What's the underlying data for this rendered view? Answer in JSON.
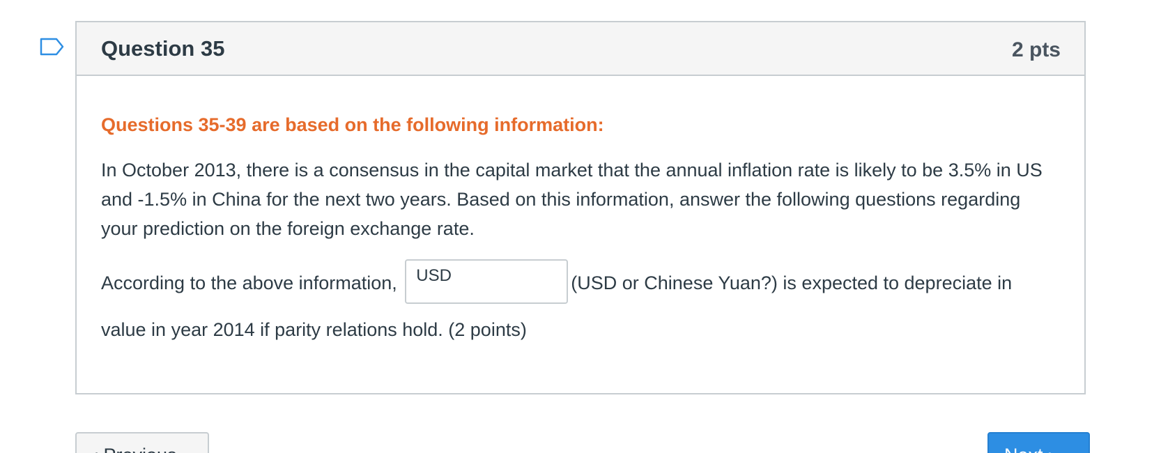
{
  "question": {
    "title": "Question 35",
    "points": "2 pts",
    "flag_icon": "flag-outline-icon",
    "intro_heading": "Questions 35-39 are based on the following information:",
    "info_text": "In October 2013, there is a consensus in the capital market that the annual inflation rate is likely to be 3.5% in US and -1.5% in China for the next two years. Based on this information, answer the following questions regarding your prediction on the foreign exchange rate.",
    "answer_prefix": "According to the above information,",
    "answer_value": "USD",
    "answer_suffix": "(USD or Chinese Yuan?) is expected to depreciate in value in year 2014 if parity relations hold. (2 points)"
  },
  "navigation": {
    "previous_label": "‹ Previous",
    "next_label": "Next ›"
  },
  "colors": {
    "heading_accent": "#e66b2b",
    "next_button": "#2d8ee3",
    "border": "#c7cdd1",
    "flag_icon": "#2d8ee3"
  }
}
